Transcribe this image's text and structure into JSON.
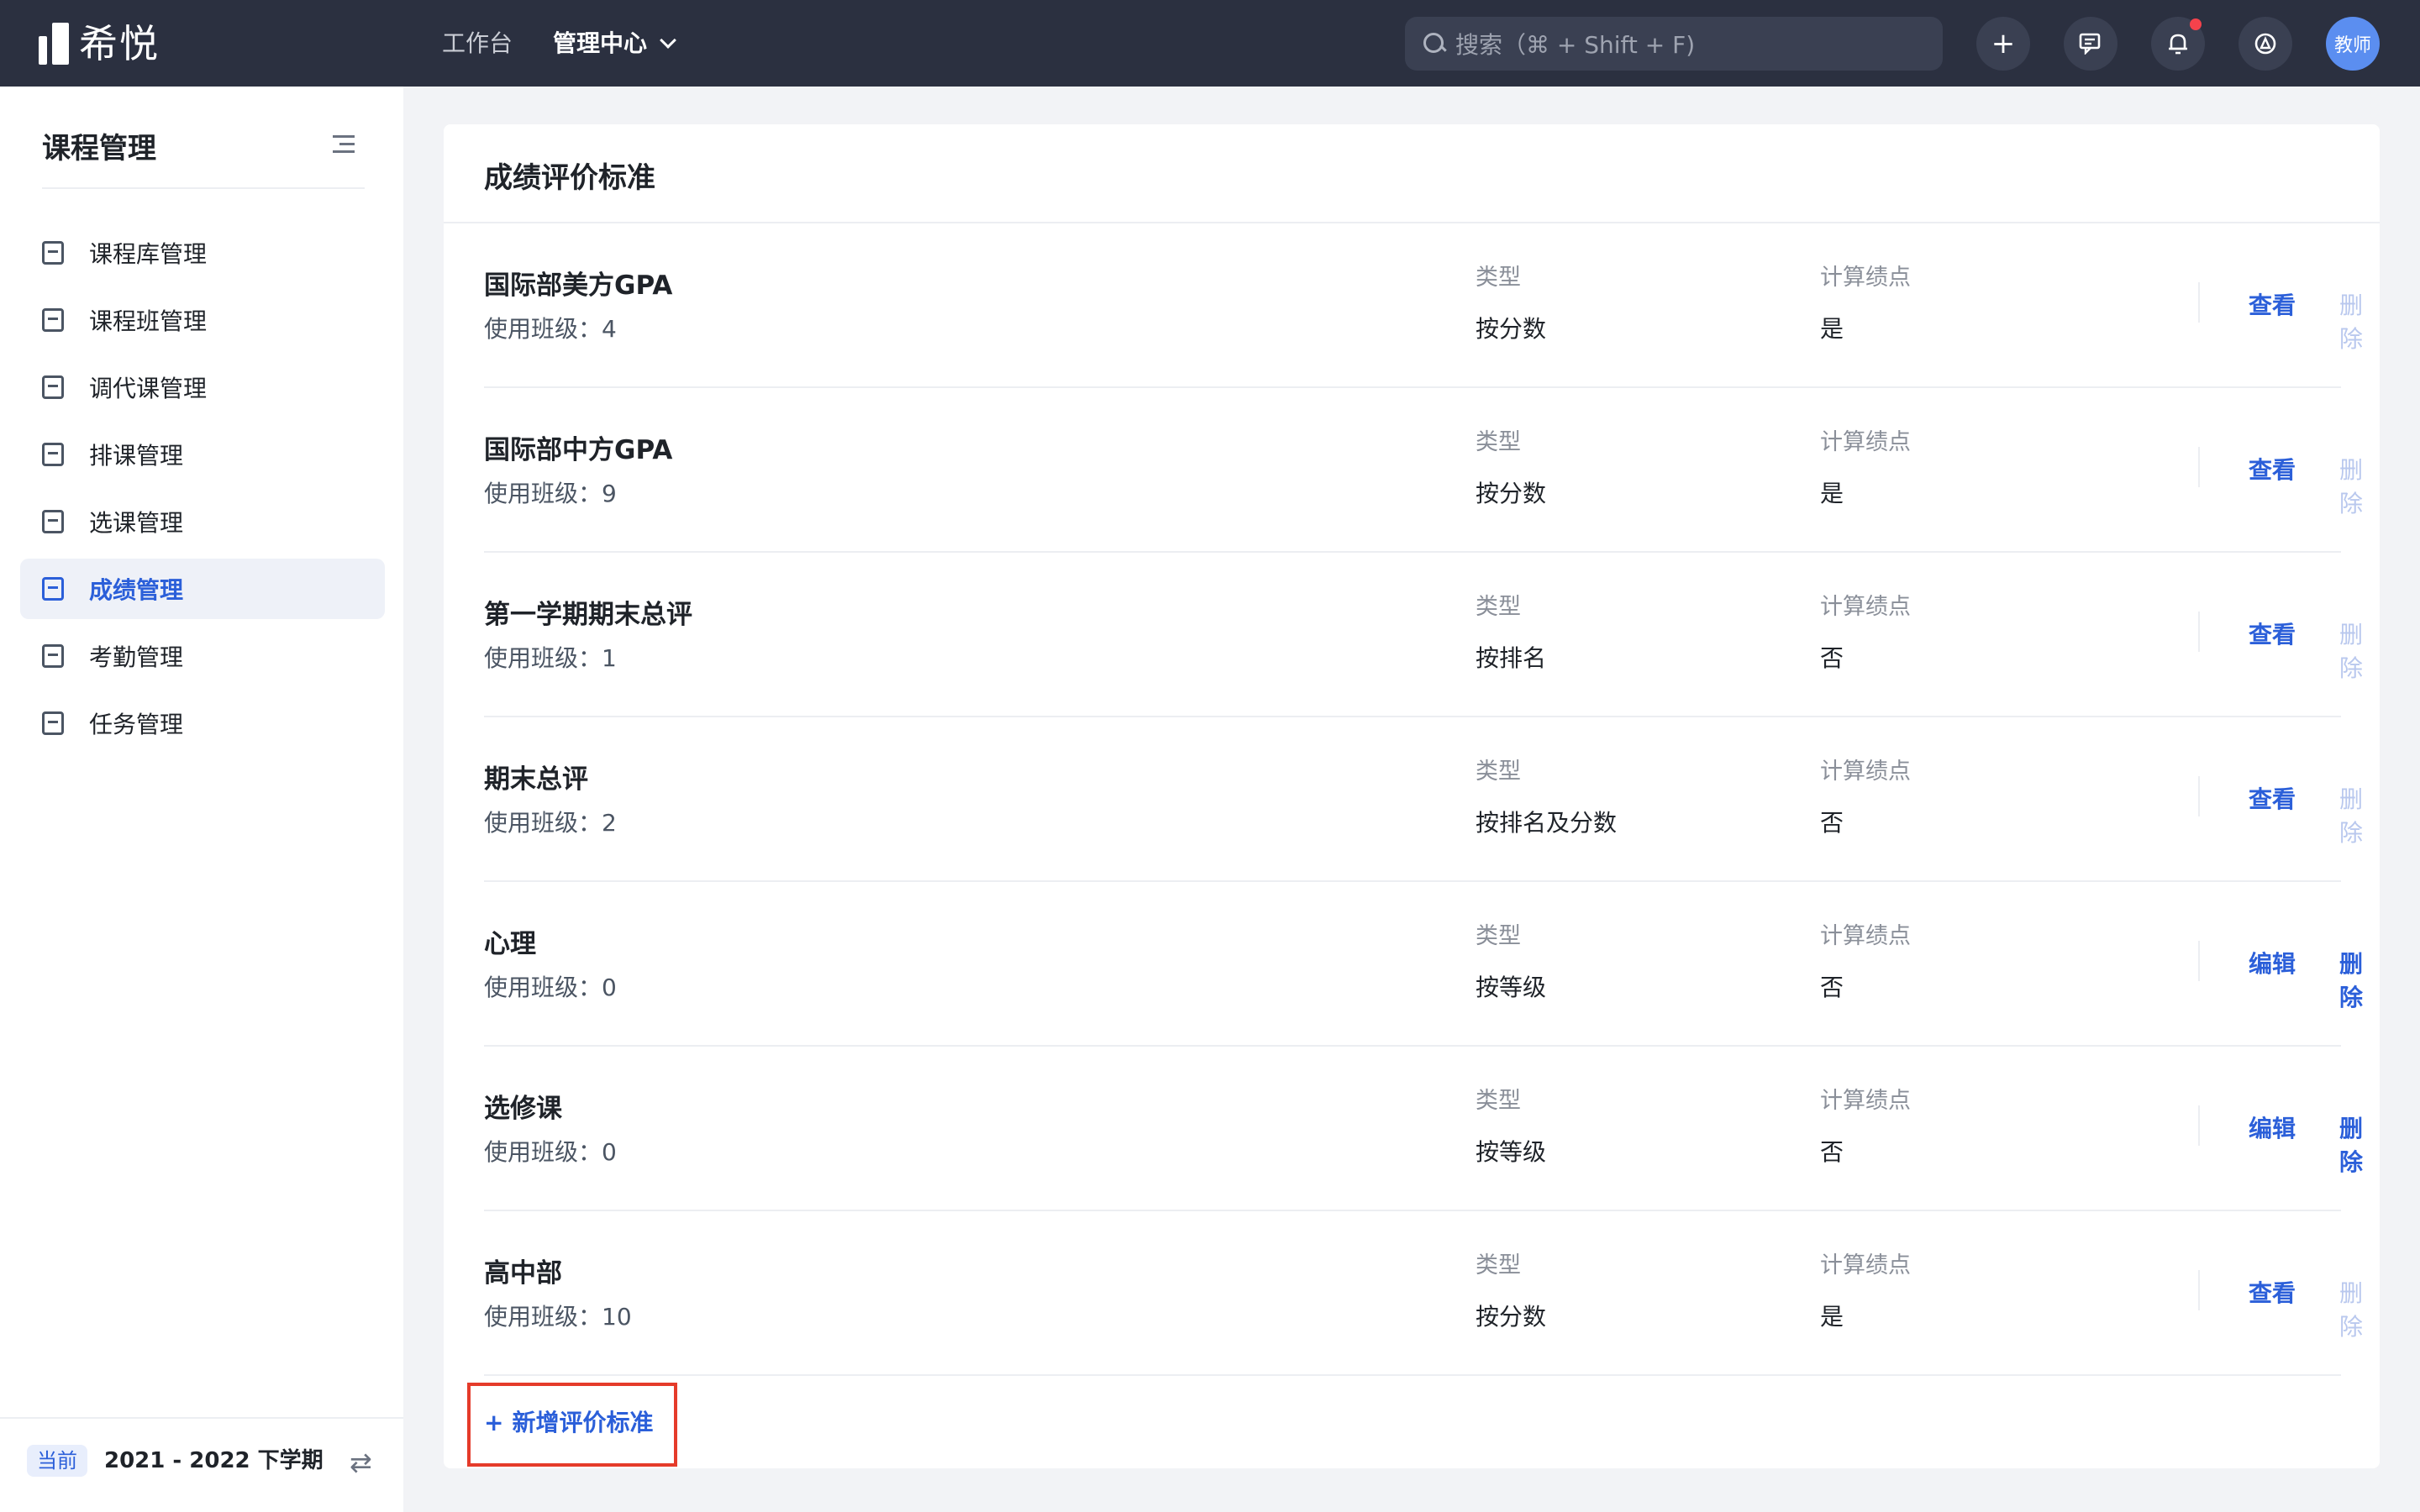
{
  "app": {
    "logo_text": "希悦"
  },
  "nav": {
    "workbench": "工作台",
    "admin": "管理中心"
  },
  "search": {
    "placeholder": "搜索（⌘ + Shift + F)"
  },
  "topbar": {
    "add_label": "+",
    "avatar_label": "教师"
  },
  "sidebar": {
    "title": "课程管理",
    "items": [
      {
        "label": "课程库管理"
      },
      {
        "label": "课程班管理"
      },
      {
        "label": "调代课管理"
      },
      {
        "label": "排课管理"
      },
      {
        "label": "选课管理"
      },
      {
        "label": "成绩管理"
      },
      {
        "label": "考勤管理"
      },
      {
        "label": "任务管理"
      }
    ],
    "active_index": 5,
    "term_badge": "当前",
    "term": "2021 - 2022 下学期"
  },
  "card": {
    "title": "成绩评价标准",
    "type_label": "类型",
    "gpa_label": "计算绩点",
    "rows": [
      {
        "name": "国际部美方GPA",
        "usage": "使用班级：4",
        "type": "按分数",
        "gpa": "是",
        "action1": "查看",
        "action2": "删除",
        "action2_enabled": false
      },
      {
        "name": "国际部中方GPA",
        "usage": "使用班级：9",
        "type": "按分数",
        "gpa": "是",
        "action1": "查看",
        "action2": "删除",
        "action2_enabled": false
      },
      {
        "name": "第一学期期末总评",
        "usage": "使用班级：1",
        "type": "按排名",
        "gpa": "否",
        "action1": "查看",
        "action2": "删除",
        "action2_enabled": false
      },
      {
        "name": "期末总评",
        "usage": "使用班级：2",
        "type": "按排名及分数",
        "gpa": "否",
        "action1": "查看",
        "action2": "删除",
        "action2_enabled": false
      },
      {
        "name": "心理",
        "usage": "使用班级：0",
        "type": "按等级",
        "gpa": "否",
        "action1": "编辑",
        "action2": "删除",
        "action2_enabled": true
      },
      {
        "name": "选修课",
        "usage": "使用班级：0",
        "type": "按等级",
        "gpa": "否",
        "action1": "编辑",
        "action2": "删除",
        "action2_enabled": true
      },
      {
        "name": "高中部",
        "usage": "使用班级：10",
        "type": "按分数",
        "gpa": "是",
        "action1": "查看",
        "action2": "删除",
        "action2_enabled": false
      }
    ],
    "add_label": "新增评价标准",
    "add_icon": "+"
  },
  "colors": {
    "accent": "#2b5fd9",
    "topbar": "#2b3040",
    "highlight": "#e53b2a"
  }
}
